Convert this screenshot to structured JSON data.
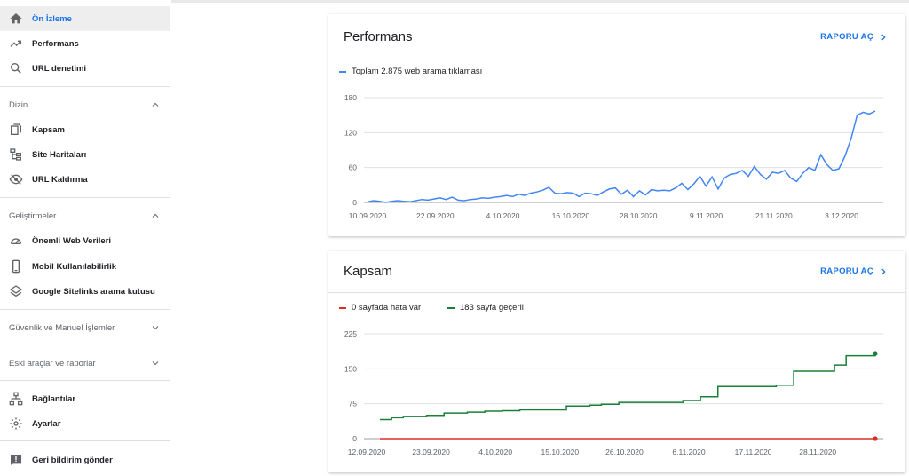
{
  "sidebar": {
    "items_top": [
      {
        "label": "Ön İzleme",
        "icon": "home-icon",
        "active": true
      },
      {
        "label": "Performans",
        "icon": "trending-up-icon",
        "active": false
      },
      {
        "label": "URL denetimi",
        "icon": "search-icon",
        "active": false
      }
    ],
    "sections": {
      "dizin": {
        "label": "Dizin",
        "items": [
          {
            "label": "Kapsam",
            "icon": "file-copy-icon"
          },
          {
            "label": "Site Haritaları",
            "icon": "sitemap-icon"
          },
          {
            "label": "URL Kaldırma",
            "icon": "visibility-off-icon"
          }
        ]
      },
      "gelistirmeler": {
        "label": "Geliştirmeler",
        "items": [
          {
            "label": "Önemli Web Verileri",
            "icon": "speed-gauge-icon"
          },
          {
            "label": "Mobil Kullanılabilirlik",
            "icon": "smartphone-icon"
          },
          {
            "label": "Google Sitelinks arama kutusu",
            "icon": "layers-icon"
          }
        ]
      },
      "guvenlik": {
        "label": "Güvenlik ve Manuel İşlemler"
      },
      "eski": {
        "label": "Eski araçlar ve raporlar"
      }
    },
    "items_bottom": [
      {
        "label": "Bağlantılar",
        "icon": "links-network-icon"
      },
      {
        "label": "Ayarlar",
        "icon": "settings-gear-icon"
      }
    ],
    "feedback": {
      "label": "Geri bildirim gönder",
      "icon": "feedback-icon"
    }
  },
  "performance_card": {
    "title": "Performans",
    "report_link": "RAPORU AÇ",
    "legend": "Toplam 2.875 web arama tıklaması"
  },
  "coverage_card": {
    "title": "Kapsam",
    "report_link": "RAPORU AÇ",
    "legend_error": "0 sayfada hata var",
    "legend_valid": "183 sayfa geçerli"
  },
  "colors": {
    "accent": "#1a73e8",
    "perf_line": "#4285f4",
    "error": "#d93025",
    "valid": "#188038"
  },
  "chart_data": [
    {
      "type": "line",
      "ylim": [
        0,
        180
      ],
      "yticks": [
        0,
        60,
        120,
        180
      ],
      "xtick_labels": [
        "10.09.2020",
        "22.09.2020",
        "4.10.2020",
        "16.10.2020",
        "28.10.2020",
        "9.11.2020",
        "21.11.2020",
        "3.12.2020"
      ],
      "series": [
        {
          "name": "Toplam 2.875 web arama tıklaması",
          "color": "#4285f4",
          "values": [
            1,
            3,
            2,
            0,
            2,
            3,
            2,
            1,
            3,
            5,
            4,
            6,
            8,
            5,
            9,
            4,
            3,
            5,
            6,
            8,
            7,
            9,
            10,
            12,
            10,
            14,
            12,
            16,
            18,
            21,
            26,
            16,
            15,
            17,
            16,
            10,
            16,
            15,
            12,
            18,
            23,
            25,
            14,
            21,
            10,
            20,
            13,
            22,
            20,
            21,
            20,
            25,
            33,
            22,
            32,
            45,
            28,
            44,
            23,
            42,
            48,
            50,
            55,
            45,
            62,
            48,
            40,
            52,
            50,
            55,
            42,
            36,
            50,
            60,
            55,
            82,
            65,
            55,
            58,
            80,
            110,
            150,
            155,
            152,
            157
          ]
        }
      ]
    },
    {
      "type": "line",
      "ylim": [
        0,
        225
      ],
      "yticks": [
        0,
        75,
        150,
        225
      ],
      "xtick_labels": [
        "12.09.2020",
        "23.09.2020",
        "4.10.2020",
        "15.10.2020",
        "26.10.2020",
        "6.11.2020",
        "17.11.2020",
        "28.11.2020"
      ],
      "series": [
        {
          "name": "0 sayfada hata var",
          "color": "#d93025",
          "values": [
            0,
            0
          ]
        },
        {
          "name": "183 sayfa geçerli",
          "color": "#188038",
          "values": [
            41,
            41,
            45,
            45,
            48,
            48,
            48,
            48,
            50,
            50,
            50,
            55,
            55,
            55,
            55,
            57,
            57,
            57,
            59,
            59,
            59,
            60,
            60,
            60,
            62,
            62,
            62,
            62,
            62,
            62,
            62,
            62,
            70,
            70,
            70,
            70,
            72,
            72,
            74,
            74,
            74,
            78,
            78,
            78,
            78,
            78,
            78,
            78,
            78,
            78,
            78,
            78,
            82,
            82,
            82,
            90,
            90,
            90,
            112,
            112,
            112,
            112,
            112,
            112,
            112,
            112,
            112,
            112,
            115,
            115,
            115,
            145,
            145,
            145,
            145,
            145,
            145,
            145,
            158,
            158,
            178,
            178,
            178,
            178,
            178,
            183
          ]
        }
      ]
    }
  ]
}
